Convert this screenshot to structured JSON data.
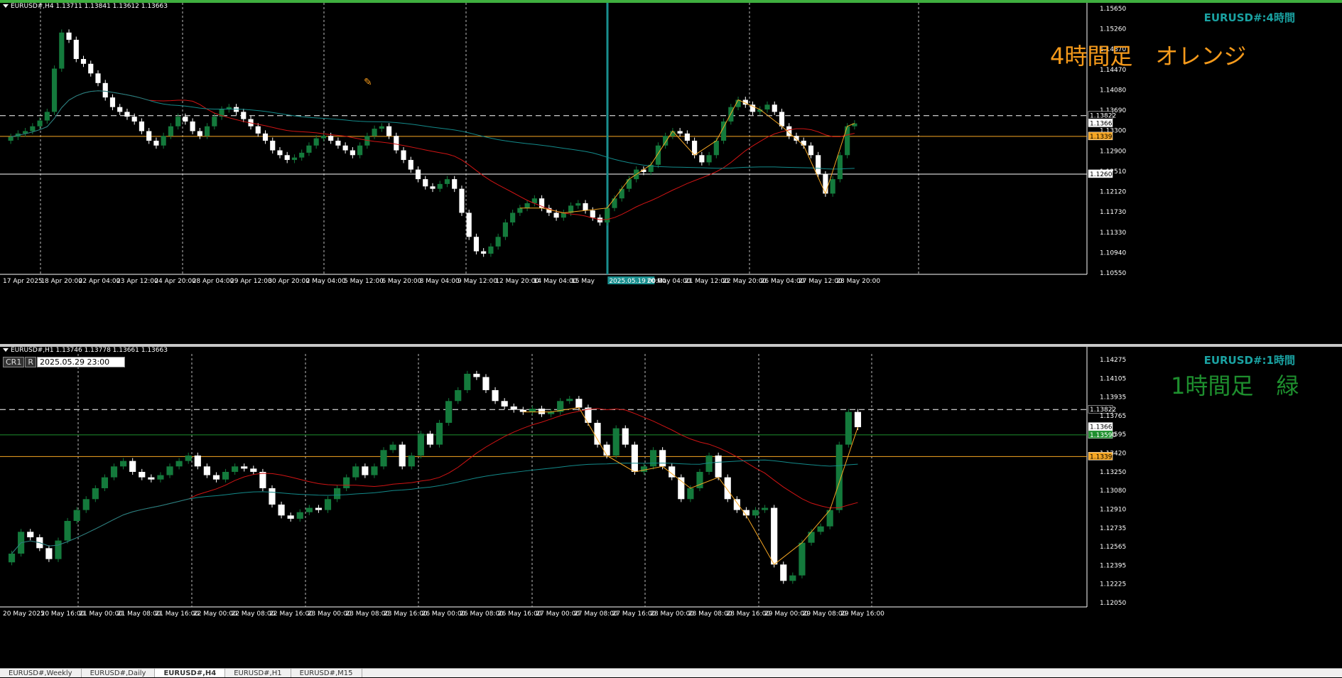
{
  "colors": {
    "up": "#147a3c",
    "down": "#ffffff",
    "ma_red": "#d01414",
    "ma_teal": "#138a8a",
    "zigzag": "#f5a623",
    "orange_line": "#f5a623",
    "grey_dash": "#ffffff"
  },
  "panels": [
    {
      "header": "EURUSD#,H4  1.13711 1.13841 1.13612 1.13663",
      "symbol_label": "EURUSD#:4時間",
      "note": "4時間足　オレンジ",
      "note_color": "#f59a1b",
      "price_ticks": [
        "1.15650",
        "1.15260",
        "1.14870",
        "1.14470",
        "1.14080",
        "1.13690",
        "1.13300",
        "1.12900",
        "1.12510",
        "1.12120",
        "1.11730",
        "1.11330",
        "1.10940",
        "1.10550"
      ],
      "price_badges": [
        {
          "value": "1.13822",
          "kind": "dash"
        },
        {
          "value": "1.13663",
          "kind": "current"
        },
        {
          "value": "1.13391",
          "kind": "orange"
        },
        {
          "value": "1.12606",
          "kind": "white"
        }
      ],
      "time_labels": [
        "17 Apr 2025",
        "18 Apr 20:00",
        "22 Apr 04:00",
        "23 Apr 12:00",
        "24 Apr 20:00",
        "28 Apr 04:00",
        "29 Apr 12:00",
        "30 Apr 20:00",
        "2 May 04:00",
        "5 May 12:00",
        "6 May 20:00",
        "8 May 04:00",
        "9 May 12:00",
        "12 May 20:00",
        "14 May 04:00",
        "15 May",
        "2025.05.19 00:00",
        "20 May 04:00",
        "21 May 12:00",
        "22 May 20:00",
        "26 May 04:00",
        "27 May 12:00",
        "28 May 20:00"
      ],
      "time_highlight": "2025.05.19 00:00"
    },
    {
      "header": "EURUSD#,H1  1.13746 1.13778 1.13661 1.13663",
      "symbol_label": "EURUSD#:1時間",
      "note": "1時間足　緑",
      "note_color": "#1e8f2e",
      "cursor_tags": [
        "CR1",
        "R"
      ],
      "cursor_time": "2025.05.29 23:00",
      "price_ticks": [
        "1.14275",
        "1.14105",
        "1.13935",
        "1.13765",
        "1.13595",
        "1.13420",
        "1.13250",
        "1.13080",
        "1.12910",
        "1.12735",
        "1.12565",
        "1.12395",
        "1.12225",
        "1.12050"
      ],
      "price_badges": [
        {
          "value": "1.13822",
          "kind": "dash"
        },
        {
          "value": "1.13663",
          "kind": "current"
        },
        {
          "value": "1.13590",
          "kind": "green"
        },
        {
          "value": "1.13391",
          "kind": "orange"
        }
      ],
      "time_labels": [
        "20 May 2025",
        "20 May 16:00",
        "21 May 00:00",
        "21 May 08:00",
        "21 May 16:00",
        "22 May 00:00",
        "22 May 08:00",
        "22 May 16:00",
        "23 May 00:00",
        "23 May 08:00",
        "23 May 16:00",
        "26 May 00:00",
        "26 May 08:00",
        "26 May 16:00",
        "27 May 00:00",
        "27 May 08:00",
        "27 May 16:00",
        "28 May 00:00",
        "28 May 08:00",
        "28 May 16:00",
        "29 May 00:00",
        "29 May 08:00",
        "29 May 16:00"
      ]
    }
  ],
  "tabs": [
    "EURUSD#,Weekly",
    "EURUSD#,Daily",
    "EURUSD#,H4",
    "EURUSD#,H1",
    "EURUSD#,M15"
  ],
  "active_tab": "EURUSD#,H4",
  "chart_data": [
    {
      "type": "candlestick",
      "title": "EURUSD#,H4",
      "ylim": [
        1.1055,
        1.1605
      ],
      "close": [
        1.1338,
        1.1345,
        1.135,
        1.136,
        1.1372,
        1.139,
        1.148,
        1.1555,
        1.154,
        1.15,
        1.149,
        1.147,
        1.145,
        1.142,
        1.14,
        1.139,
        1.138,
        1.137,
        1.135,
        1.133,
        1.132,
        1.134,
        1.136,
        1.138,
        1.137,
        1.135,
        1.134,
        1.136,
        1.138,
        1.1395,
        1.14,
        1.139,
        1.1375,
        1.136,
        1.1345,
        1.133,
        1.131,
        1.13,
        1.129,
        1.1295,
        1.1305,
        1.132,
        1.1335,
        1.134,
        1.133,
        1.132,
        1.131,
        1.13,
        1.132,
        1.134,
        1.1355,
        1.136,
        1.134,
        1.131,
        1.129,
        1.127,
        1.125,
        1.1235,
        1.123,
        1.124,
        1.125,
        1.123,
        1.118,
        1.113,
        1.11,
        1.1095,
        1.111,
        1.113,
        1.116,
        1.118,
        1.119,
        1.12,
        1.121,
        1.119,
        1.118,
        1.117,
        1.118,
        1.1195,
        1.12,
        1.1185,
        1.117,
        1.116,
        1.119,
        1.121,
        1.123,
        1.125,
        1.127,
        1.1265,
        1.128,
        1.132,
        1.134,
        1.135,
        1.1345,
        1.133,
        1.13,
        1.1285,
        1.13,
        1.133,
        1.137,
        1.14,
        1.1415,
        1.1405,
        1.139,
        1.1395,
        1.1405,
        1.139,
        1.136,
        1.134,
        1.133,
        1.132,
        1.13,
        1.126,
        1.122,
        1.125,
        1.13,
        1.136,
        1.1366
      ]
    },
    {
      "type": "candlestick",
      "title": "EURUSD#,H1",
      "ylim": [
        1.1205,
        1.1428
      ],
      "close": [
        1.125,
        1.127,
        1.1265,
        1.1255,
        1.1245,
        1.1262,
        1.128,
        1.129,
        1.13,
        1.131,
        1.132,
        1.133,
        1.1335,
        1.1325,
        1.132,
        1.1318,
        1.1322,
        1.133,
        1.1335,
        1.134,
        1.133,
        1.1322,
        1.1318,
        1.1325,
        1.133,
        1.1328,
        1.1325,
        1.131,
        1.1295,
        1.1285,
        1.1282,
        1.1288,
        1.1292,
        1.129,
        1.13,
        1.131,
        1.132,
        1.133,
        1.1322,
        1.133,
        1.1345,
        1.135,
        1.133,
        1.134,
        1.136,
        1.135,
        1.137,
        1.139,
        1.14,
        1.1415,
        1.1412,
        1.14,
        1.139,
        1.1385,
        1.1382,
        1.138,
        1.1383,
        1.1378,
        1.138,
        1.139,
        1.1392,
        1.1384,
        1.137,
        1.135,
        1.134,
        1.1365,
        1.135,
        1.1325,
        1.133,
        1.1345,
        1.133,
        1.132,
        1.13,
        1.131,
        1.1325,
        1.134,
        1.132,
        1.13,
        1.129,
        1.1285,
        1.129,
        1.1292,
        1.124,
        1.1225,
        1.123,
        1.126,
        1.127,
        1.1275,
        1.129,
        1.135,
        1.138,
        1.1366
      ]
    }
  ]
}
